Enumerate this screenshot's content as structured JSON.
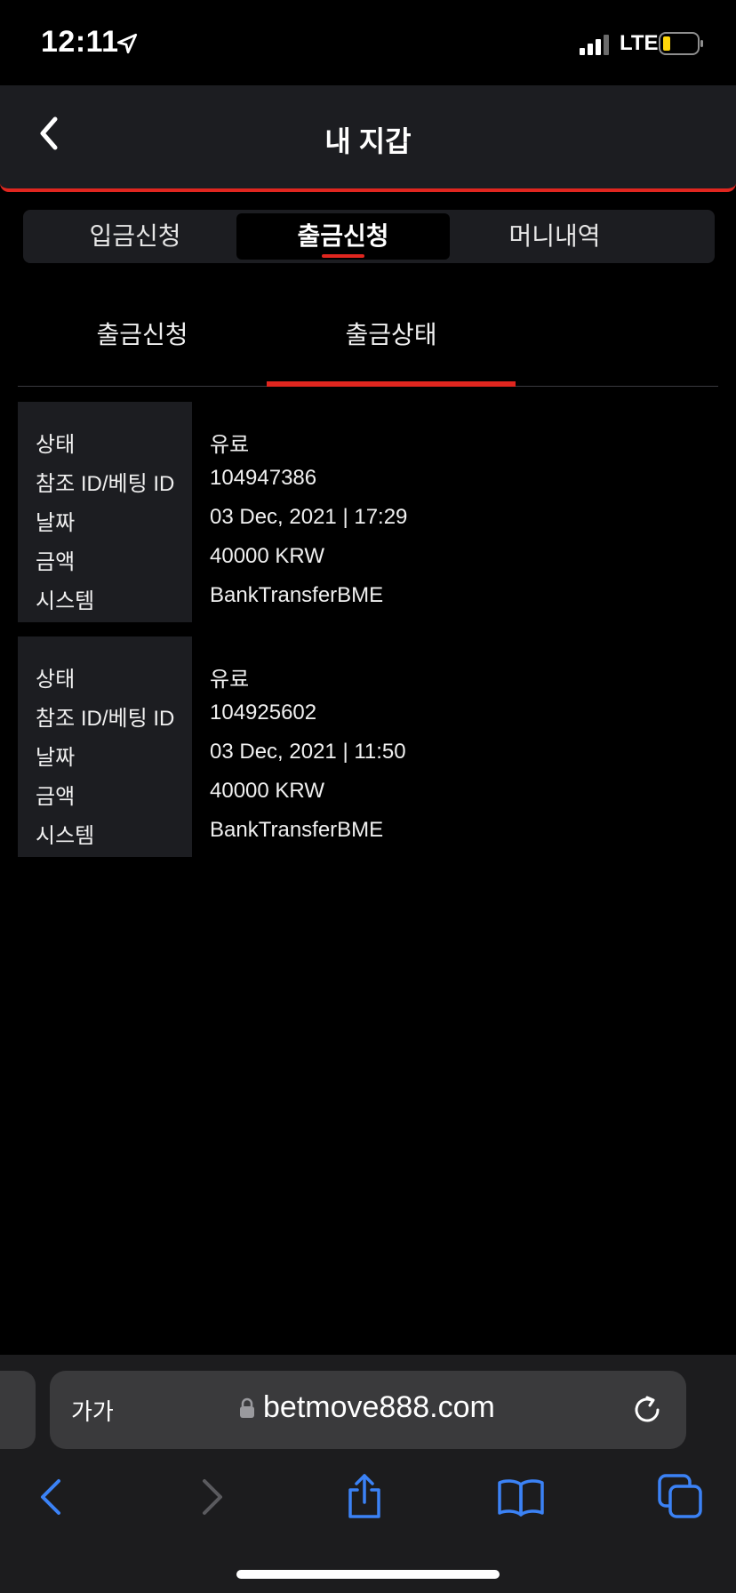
{
  "status_bar": {
    "time": "12:11",
    "network": "LTE"
  },
  "header": {
    "title": "내 지갑"
  },
  "wallet_tabs": [
    {
      "label": "입금신청"
    },
    {
      "label": "출금신청"
    },
    {
      "label": "머니내역"
    }
  ],
  "wallet_active_tab": "출금신청",
  "sub_tabs": [
    {
      "label": "출금신청"
    },
    {
      "label": "출금상태"
    }
  ],
  "sub_active_tab": "출금상태",
  "records": [
    {
      "labels": [
        "상태",
        "참조 ID/베팅 ID",
        "날짜",
        "금액",
        "시스템"
      ],
      "status": "유료",
      "ref_id": "104947386",
      "date": "03 Dec, 2021 | 17:29",
      "amount": "40000 KRW",
      "system": "BankTransferBME"
    },
    {
      "labels": [
        "상태",
        "참조 ID/베팅 ID",
        "날짜",
        "금액",
        "시스템"
      ],
      "status": "유료",
      "ref_id": "104925602",
      "date": "03 Dec, 2021 | 11:50",
      "amount": "40000 KRW",
      "system": "BankTransferBME"
    }
  ],
  "browser": {
    "reader_label": "가가",
    "url": "betmove888.com"
  },
  "colors": {
    "accent": "#e0261f",
    "panel": "#1c1d21",
    "background": "#000000",
    "browser_blue": "#3b82f6"
  },
  "icons": {
    "back": "chevron-left-icon",
    "lock": "lock-icon",
    "reload": "reload-icon",
    "browser_back": "chevron-left-icon",
    "browser_forward": "chevron-right-icon",
    "share": "share-icon",
    "bookmarks": "book-icon",
    "tabs": "tabs-icon"
  }
}
